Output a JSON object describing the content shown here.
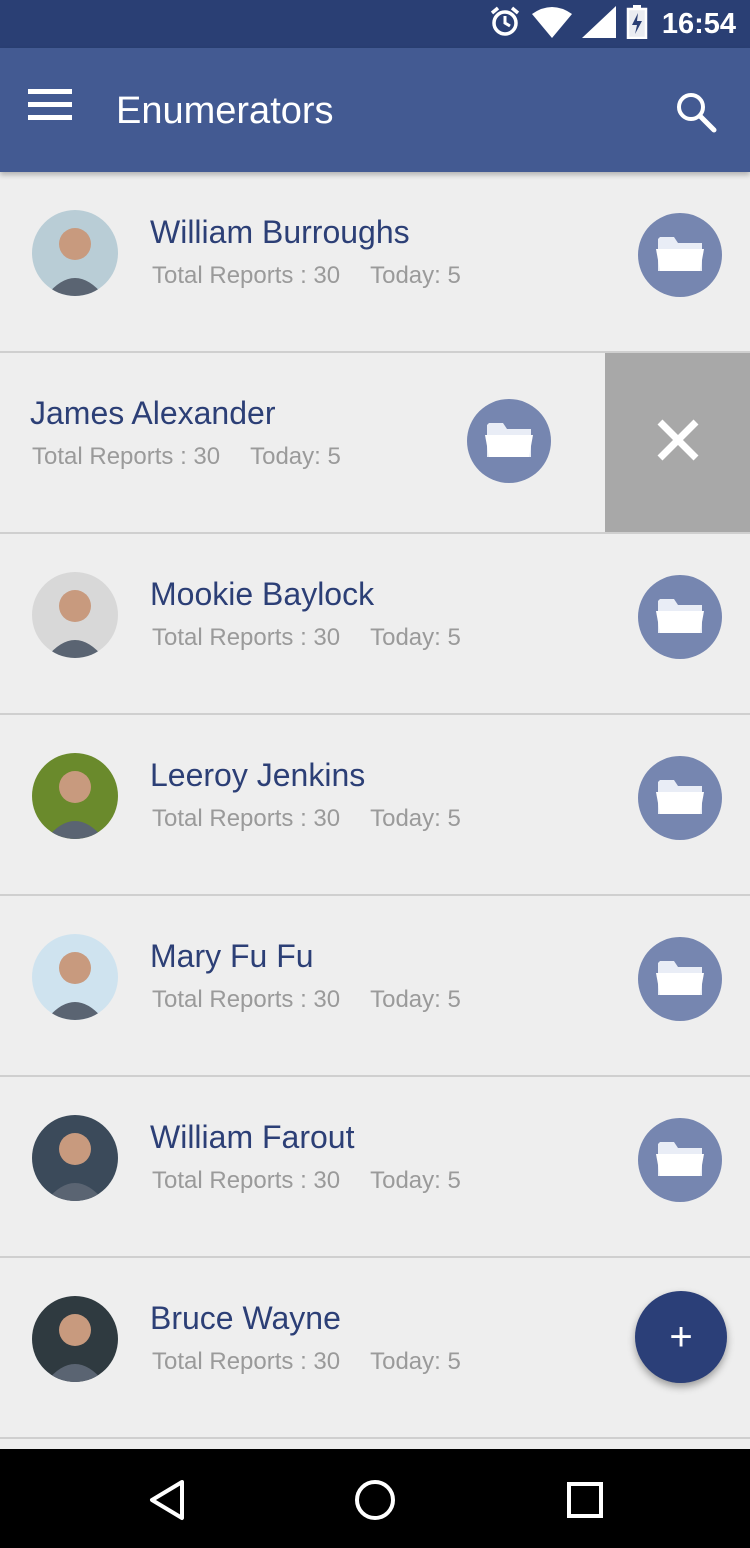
{
  "status_bar": {
    "time": "16:54"
  },
  "app_bar": {
    "title": "Enumerators",
    "menu_icon": "hamburger-menu-icon",
    "search_icon": "search-icon"
  },
  "enumerators": [
    {
      "name": "William Burroughs",
      "total_reports": "Total Reports : 30",
      "today": "Today: 5",
      "avatar_color": "#b9cdd6"
    },
    {
      "name": "James Alexander",
      "total_reports": "Total Reports : 30",
      "today": "Today: 5",
      "swiped": true
    },
    {
      "name": "Mookie Baylock",
      "total_reports": "Total Reports : 30",
      "today": "Today: 5",
      "avatar_color": "#d8d8d8"
    },
    {
      "name": "Leeroy Jenkins",
      "total_reports": "Total Reports : 30",
      "today": "Today: 5",
      "avatar_color": "#6a8a2c"
    },
    {
      "name": "Mary Fu Fu",
      "total_reports": "Total Reports : 30",
      "today": "Today: 5",
      "avatar_color": "#cfe3ef"
    },
    {
      "name": "William Farout",
      "total_reports": "Total Reports : 30",
      "today": "Today: 5",
      "avatar_color": "#3b4a5a"
    },
    {
      "name": "Bruce Wayne",
      "total_reports": "Total Reports : 30",
      "today": "Today: 5",
      "avatar_color": "#2f3a40"
    }
  ],
  "actions": {
    "folder_icon": "folder-icon",
    "delete_icon": "close-icon",
    "fab_label": "+"
  },
  "colors": {
    "primary": "#435a92",
    "primary_dark": "#2a3f74",
    "accent": "#2b3f78",
    "folder_circle": "#7686b0",
    "name_text": "#2c3f76",
    "meta_text": "#9a9a9a"
  }
}
